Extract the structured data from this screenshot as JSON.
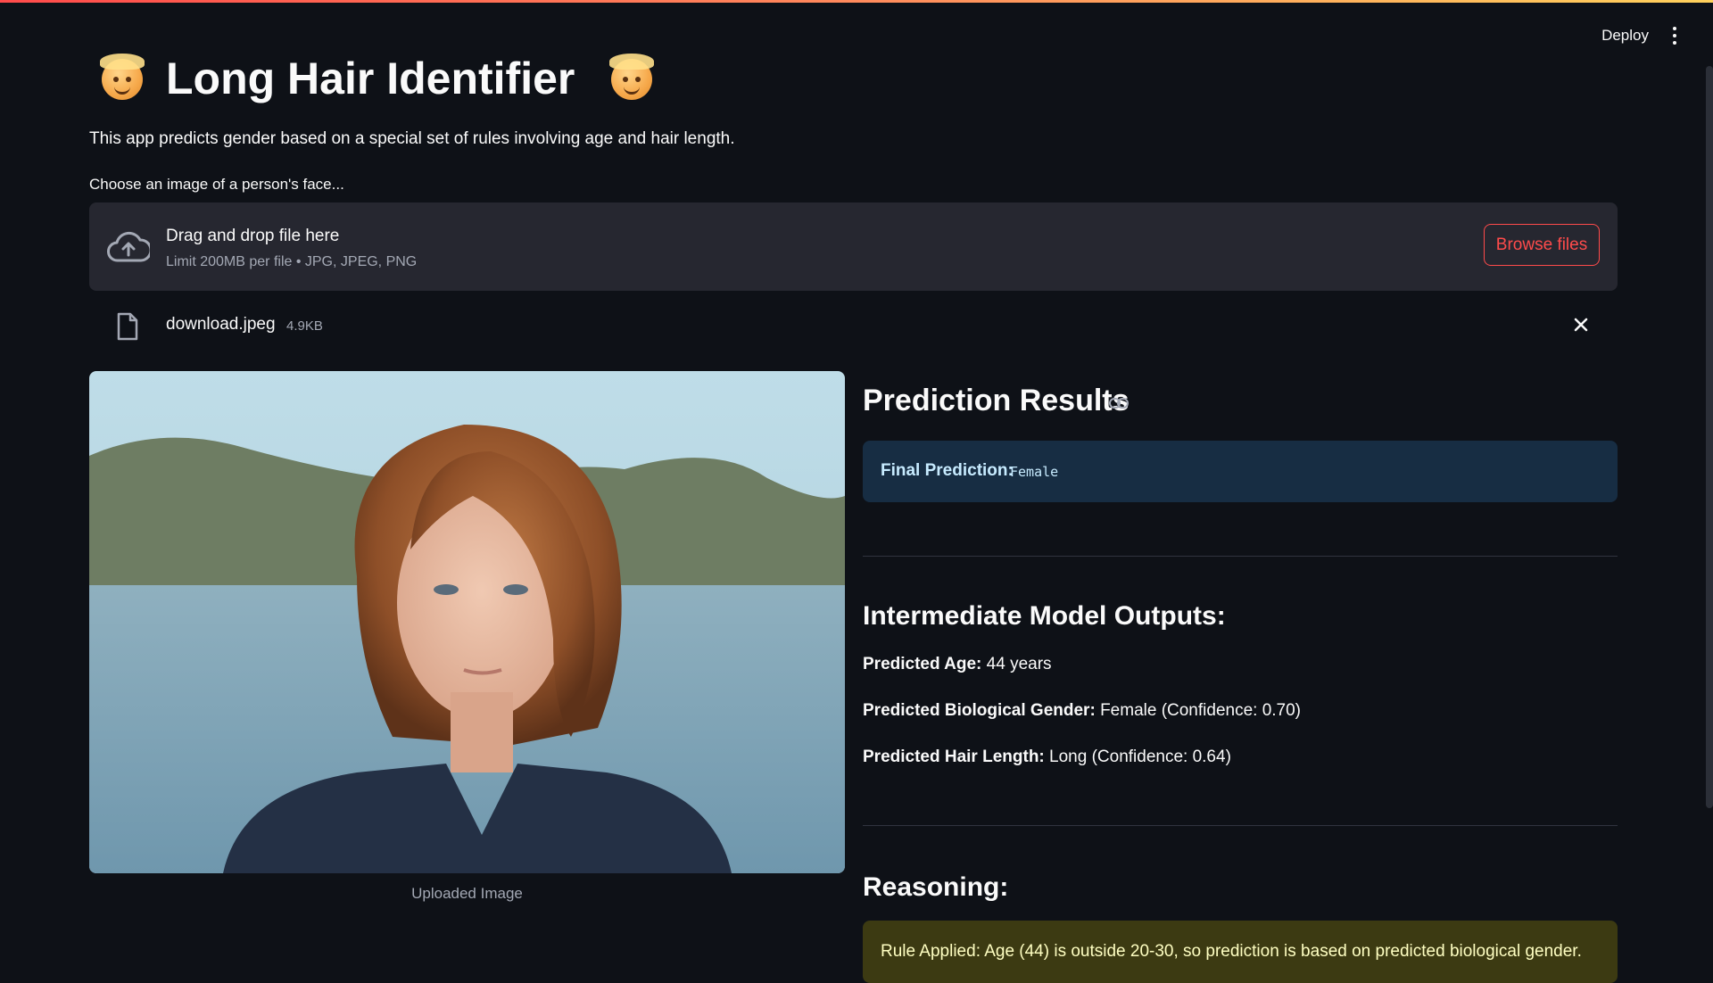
{
  "app": {
    "title": "Long Hair Identifier",
    "description": "This app predicts gender based on a special set of rules involving age and hair length.",
    "toolbar": {
      "deploy_label": "Deploy"
    }
  },
  "uploader": {
    "label": "Choose an image of a person's face...",
    "drop_text": "Drag and drop file here",
    "limit_text": "Limit 200MB per file • JPG, JPEG, PNG",
    "browse_label": "Browse files",
    "file": {
      "name": "download.jpeg",
      "size": "4.9KB"
    }
  },
  "image": {
    "caption": "Uploaded Image"
  },
  "results": {
    "heading": "Prediction Results",
    "final_label": "Final Prediction:",
    "final_value": "Female",
    "intermediate_heading": "Intermediate Model Outputs:",
    "age_label": "Predicted Age:",
    "age_value": "44 years",
    "gender_label": "Predicted Biological Gender:",
    "gender_value": "Female (Confidence: 0.70)",
    "hair_label": "Predicted Hair Length:",
    "hair_value": "Long (Confidence: 0.64)",
    "reasoning_heading": "Reasoning:",
    "rule_text": "Rule Applied: Age (44) is outside 20-30, so prediction is based on predicted biological gender."
  },
  "colors": {
    "background": "#0e1117",
    "accent": "#ff4b4b",
    "info_bg": "#172d43",
    "warn_bg": "#3c3a12"
  }
}
